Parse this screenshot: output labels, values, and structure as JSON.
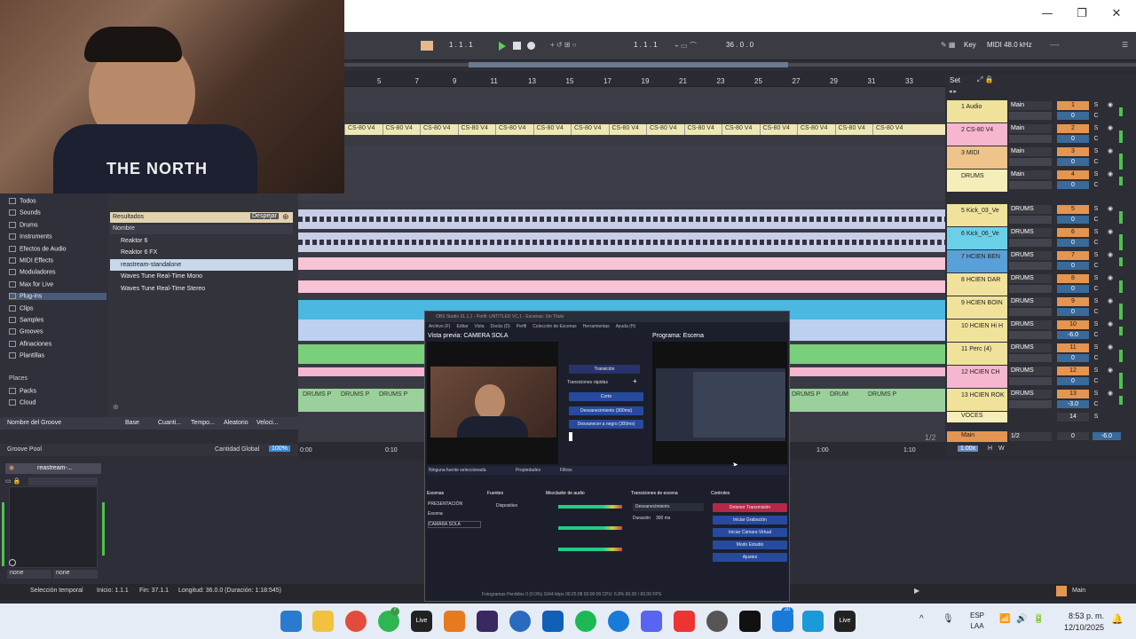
{
  "window": {
    "minimize": "—",
    "restore": "❐",
    "close": "✕"
  },
  "toolbar": {
    "pos1": "1 . 1 . 1",
    "pos2": "1 . 1 . 1",
    "length": "36 . 0 . 0",
    "key": "Key",
    "midi_rate": "MIDI  48.0 kHz",
    "dashes": "----"
  },
  "ruler": [
    "5",
    "7",
    "9",
    "11",
    "13",
    "15",
    "17",
    "19",
    "21",
    "23",
    "25",
    "27",
    "29",
    "31",
    "33"
  ],
  "set_label": "Set",
  "clips": {
    "cs80": "CS-80 V4",
    "drums": "DRUMS P",
    "drum_short": "DRUM"
  },
  "tracks": [
    {
      "name": "1 Audio",
      "route": "Main",
      "num": "1",
      "vol": "0",
      "color": "#f0e29a"
    },
    {
      "name": "2 CS-80 V4",
      "route": "Main",
      "num": "2",
      "vol": "0",
      "color": "#f6b6cf"
    },
    {
      "name": "3 MIDI",
      "route": "Main",
      "num": "3",
      "vol": "0",
      "color": "#eec48a"
    },
    {
      "name": "DRUMS",
      "route": "Main",
      "num": "4",
      "vol": "0",
      "color": "#f6eeb8"
    },
    {
      "name": "5 Kick_03_Ve",
      "route": "DRUMS",
      "num": "5",
      "vol": "0",
      "color": "#f0e29a"
    },
    {
      "name": "6 Kick_06_Ve",
      "route": "DRUMS",
      "num": "6",
      "vol": "0",
      "color": "#6ad0e8"
    },
    {
      "name": "7 HCIEN BEN",
      "route": "DRUMS",
      "num": "7",
      "vol": "0",
      "color": "#5aa0d8"
    },
    {
      "name": "8 HCIEN DAR",
      "route": "DRUMS",
      "num": "8",
      "vol": "0",
      "color": "#f0e29a"
    },
    {
      "name": "9 HCIEN BOIN",
      "route": "DRUMS",
      "num": "9",
      "vol": "0",
      "color": "#f0e29a"
    },
    {
      "name": "10 HCIEN Hi H",
      "route": "DRUMS",
      "num": "10",
      "vol": "-6.0",
      "color": "#f0e29a"
    },
    {
      "name": "11 Perc (4)",
      "route": "DRUMS",
      "num": "11",
      "vol": "0",
      "color": "#f0e29a"
    },
    {
      "name": "12 HCIEN CH",
      "route": "DRUMS",
      "num": "12",
      "vol": "0",
      "color": "#f6b6cf"
    },
    {
      "name": "13 HCIEN ROK",
      "route": "DRUMS",
      "num": "13",
      "vol": "-3.0",
      "color": "#f0e29a"
    }
  ],
  "voces": {
    "name": "VOCES",
    "num": "14"
  },
  "master": {
    "name": "Main",
    "route": "1/2",
    "vol": "0",
    "db": "-6.0",
    "tempo": "1.00x",
    "h": "H",
    "w": "W",
    "count": "1/2"
  },
  "browser": {
    "categories": [
      "Todos",
      "Sounds",
      "Drums",
      "Instruments",
      "Efectos de Audio",
      "MIDI Effects",
      "Moduladores",
      "Max for Live",
      "Plug-ins",
      "Clips",
      "Samples",
      "Grooves",
      "Afinaciones",
      "Plantillas"
    ],
    "places_title": "Places",
    "places": [
      "Packs",
      "Cloud"
    ],
    "results_label": "Resultados",
    "clear_label": "Despejar",
    "column_name": "Nombre",
    "results": [
      "Reaktor 6",
      "Reaktor 6 FX",
      "reastream-standalone",
      "Waves Tune Real-Time Mono",
      "Waves Tune Real-Time Stereo"
    ]
  },
  "groove": {
    "cols": [
      "Nombre del Groove",
      "Base",
      "Cuanti...",
      "Tempo...",
      "Aleatorio",
      "Veloci..."
    ],
    "pool": "Groove Pool",
    "global": "Cantidad Global",
    "pct": "100%"
  },
  "timeline": {
    "t0": "0:00",
    "t1": "0:10",
    "t2": "1:00",
    "t3": "1:10"
  },
  "device": {
    "name": "reastream-...",
    "none1": "none",
    "none2": "none"
  },
  "status": {
    "sel": "Selección temporal",
    "start": "Inicio: 1.1.1",
    "end": "Fin: 37.1.1",
    "len": "Longitud: 36.0.0 (Duración: 1:18:545)",
    "main": "Main"
  },
  "obs": {
    "title": "OBS Studio 31.1.1 - Perfil: UNTITLED VC.1 - Escenas: Sin Título",
    "menu": [
      "Archivo (F)",
      "Editar",
      "Vista",
      "Docks (D)",
      "Perfil",
      "Colección de Escenas",
      "Herramientas",
      "Ayuda (H)"
    ],
    "preview": "Vista previa: CAMERA SOLA",
    "program": "Programa: Escena",
    "transition": "Transición",
    "quick": "Transiciones rápidas",
    "corte": "Corte",
    "fade1": "Desvanecimiento (300ms)",
    "fade2": "Desvanecer a negro (300ms)",
    "nosource": "Ninguna fuente seleccionada",
    "props": "Propiedades",
    "filters": "Filtros",
    "docks": [
      "Escenas",
      "Fuentes",
      "Mezclador de audio",
      "Transiciones de escena",
      "Controles"
    ],
    "scenes": [
      "PRESENTACIÓN",
      "Escena",
      "CAMARA SOLA"
    ],
    "source": "Dispositivo",
    "trans_sel": "Desvanecimiento",
    "duration_lbl": "Duración",
    "duration": "300 ms",
    "controls": [
      "Detener Transmisión",
      "Iniciar Grabación",
      "Iniciar Cámara Virtual",
      "Modo Estudio",
      "Ajustes"
    ],
    "footer": "Fotogramas Perdidos 0 (0.0%)   1644 kbps   00:25:08   00:00:00   CPU: 6.8%   60.00 / 60.00 FPS"
  },
  "taskbar": {
    "lang1": "ESP",
    "lang2": "LAA",
    "time": "8:53 p. m.",
    "date": "12/10/2025",
    "badge1": "7",
    "badge2": "20",
    "live": "Live"
  }
}
